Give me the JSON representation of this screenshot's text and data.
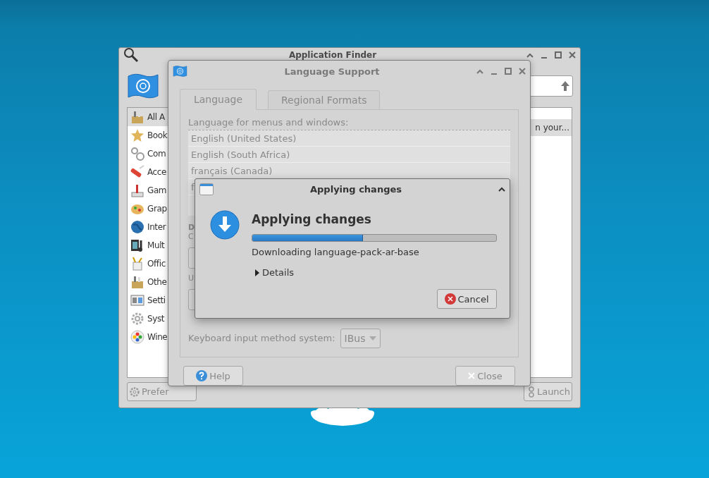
{
  "app_finder": {
    "title": "Application Finder",
    "categories": [
      {
        "label": "All A",
        "selected": true
      },
      {
        "label": "Book",
        "selected": false
      },
      {
        "label": "Com",
        "selected": false
      },
      {
        "label": "Acce",
        "selected": false
      },
      {
        "label": "Gam",
        "selected": false
      },
      {
        "label": "Grap",
        "selected": false
      },
      {
        "label": "Inter",
        "selected": false
      },
      {
        "label": "Mult",
        "selected": false
      },
      {
        "label": "Offic",
        "selected": false
      },
      {
        "label": "Othe",
        "selected": false
      },
      {
        "label": "Setti",
        "selected": false
      },
      {
        "label": "Syst",
        "selected": false
      },
      {
        "label": "Wine",
        "selected": false
      }
    ],
    "results_header": "n your...",
    "buttons": [
      "Prefer",
      "Launch"
    ]
  },
  "language_support": {
    "title": "Language Support",
    "disabled": true,
    "tabs": [
      {
        "label": "Language",
        "selected": true
      },
      {
        "label": "Regional Formats",
        "selected": false
      }
    ],
    "list_label": "Language for menus and windows:",
    "languages": [
      "English (United States)",
      "English (South Africa)",
      "français (Canada)",
      "f"
    ],
    "fragments": [
      {
        "kind": "heading",
        "text": "D"
      },
      {
        "kind": "text",
        "text": "C"
      },
      {
        "kind": "button"
      },
      {
        "kind": "text",
        "text": "U"
      },
      {
        "kind": "button"
      }
    ],
    "input_method_label": "Keyboard input method system:",
    "input_method": "IBus",
    "buttons": [
      {
        "label": "Help",
        "kind": "help"
      },
      {
        "label": "Close",
        "kind": "close"
      }
    ]
  },
  "progress_dialog": {
    "title": "Applying changes",
    "heading": "Applying changes",
    "progress": {
      "level": 0.45
    },
    "status": "Downloading language-pack-ar-base",
    "details": {
      "label": "Details",
      "expanded": false
    },
    "buttons": [
      {
        "label": "Cancel",
        "kind": "cancel"
      }
    ]
  }
}
